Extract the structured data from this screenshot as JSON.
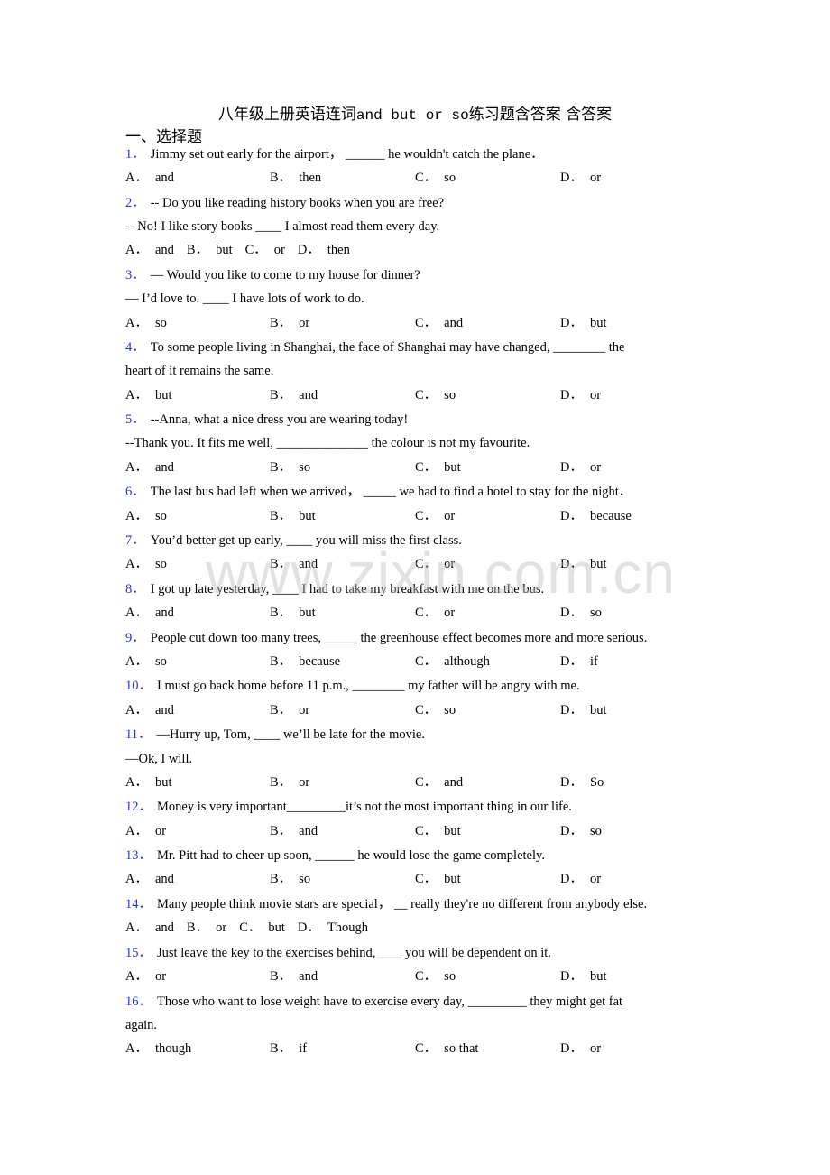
{
  "document": {
    "title_cn_prefix": "八年级上册英语连词",
    "title_en": "and but or  so",
    "title_cn_suffix": "练习题含答案 含答案",
    "section_heading": "一、选择题",
    "watermark": "www.zixin.com.cn",
    "accent_color": "#2a35d8"
  },
  "questions": [
    {
      "num": "1．",
      "lines": [
        "Jimmy set out early for the airport， ______ he wouldn't catch the plane．"
      ],
      "options": [
        {
          "letter": "A．",
          "text": "and"
        },
        {
          "letter": "B．",
          "text": "then"
        },
        {
          "letter": "C．",
          "text": "so"
        },
        {
          "letter": "D．",
          "text": "or"
        }
      ],
      "layout": "grid"
    },
    {
      "num": "2．",
      "lines": [
        "-- Do you like reading history books when you are free?",
        "-- No! I like story books ____ I almost read them every day."
      ],
      "options": [
        {
          "letter": "A．",
          "text": "and"
        },
        {
          "letter": "B．",
          "text": "but"
        },
        {
          "letter": "C．",
          "text": "or"
        },
        {
          "letter": "D．",
          "text": "then"
        }
      ],
      "layout": "inline"
    },
    {
      "num": "3．",
      "lines": [
        "— Would you like to come to my house for dinner?",
        "— I’d love to. ____ I have lots of work to do."
      ],
      "options": [
        {
          "letter": "A．",
          "text": "so"
        },
        {
          "letter": "B．",
          "text": "or"
        },
        {
          "letter": "C．",
          "text": "and"
        },
        {
          "letter": "D．",
          "text": "but"
        }
      ],
      "layout": "grid"
    },
    {
      "num": "4．",
      "lines": [
        "To some people living in Shanghai, the face of Shanghai may have changed, ________ the",
        "heart of it remains the same."
      ],
      "options": [
        {
          "letter": "A．",
          "text": "but"
        },
        {
          "letter": "B．",
          "text": "and"
        },
        {
          "letter": "C．",
          "text": "so"
        },
        {
          "letter": "D．",
          "text": "or"
        }
      ],
      "layout": "grid"
    },
    {
      "num": "5．",
      "lines": [
        "--Anna, what a nice dress you are wearing today!",
        "--Thank you. It fits me well, ______________ the colour is not my favourite."
      ],
      "options": [
        {
          "letter": "A．",
          "text": "and"
        },
        {
          "letter": "B．",
          "text": "so"
        },
        {
          "letter": "C．",
          "text": "but"
        },
        {
          "letter": "D．",
          "text": "or"
        }
      ],
      "layout": "grid"
    },
    {
      "num": "6．",
      "lines": [
        "The last bus had left when we arrived， _____ we had to find a hotel to stay for the night．"
      ],
      "options": [
        {
          "letter": "A．",
          "text": "so"
        },
        {
          "letter": "B．",
          "text": "but"
        },
        {
          "letter": "C．",
          "text": "or"
        },
        {
          "letter": "D．",
          "text": "because"
        }
      ],
      "layout": "grid"
    },
    {
      "num": "7．",
      "lines": [
        "You’d better get up early, ____ you will miss the first class."
      ],
      "options": [
        {
          "letter": "A．",
          "text": "so"
        },
        {
          "letter": "B．",
          "text": "and"
        },
        {
          "letter": "C．",
          "text": "or"
        },
        {
          "letter": "D．",
          "text": "but"
        }
      ],
      "layout": "grid"
    },
    {
      "num": "8．",
      "lines": [
        "I got up late yesterday, ____ I had to take my breakfast with me on the bus."
      ],
      "options": [
        {
          "letter": "A．",
          "text": "and"
        },
        {
          "letter": "B．",
          "text": "but"
        },
        {
          "letter": "C．",
          "text": "or"
        },
        {
          "letter": "D．",
          "text": "so"
        }
      ],
      "layout": "grid"
    },
    {
      "num": "9．",
      "lines": [
        "People cut down too many trees, _____ the greenhouse effect becomes more and more serious."
      ],
      "options": [
        {
          "letter": "A．",
          "text": "so"
        },
        {
          "letter": "B．",
          "text": "because"
        },
        {
          "letter": "C．",
          "text": "although"
        },
        {
          "letter": "D．",
          "text": "if"
        }
      ],
      "layout": "grid"
    },
    {
      "num": "10．",
      "lines": [
        "I must go back home before 11 p.m., ________ my father will be angry with me."
      ],
      "options": [
        {
          "letter": "A．",
          "text": "and"
        },
        {
          "letter": "B．",
          "text": "or"
        },
        {
          "letter": "C．",
          "text": "so"
        },
        {
          "letter": "D．",
          "text": "but"
        }
      ],
      "layout": "grid"
    },
    {
      "num": "11．",
      "lines": [
        "—Hurry up, Tom, ____ we’ll be late for the movie.",
        "—Ok, I will."
      ],
      "options": [
        {
          "letter": "A．",
          "text": "but"
        },
        {
          "letter": "B．",
          "text": "or"
        },
        {
          "letter": "C．",
          "text": "and"
        },
        {
          "letter": "D．",
          "text": "So"
        }
      ],
      "layout": "grid"
    },
    {
      "num": "12．",
      "lines": [
        "Money is very important_________it’s not the most important thing in our life."
      ],
      "options": [
        {
          "letter": "A．",
          "text": "or"
        },
        {
          "letter": "B．",
          "text": "and"
        },
        {
          "letter": "C．",
          "text": "but"
        },
        {
          "letter": "D．",
          "text": "so"
        }
      ],
      "layout": "grid"
    },
    {
      "num": "13．",
      "lines": [
        "Mr. Pitt had to cheer up soon, ______ he would lose the game completely."
      ],
      "options": [
        {
          "letter": "A．",
          "text": "and"
        },
        {
          "letter": "B．",
          "text": "so"
        },
        {
          "letter": "C．",
          "text": "but"
        },
        {
          "letter": "D．",
          "text": "or"
        }
      ],
      "layout": "grid"
    },
    {
      "num": "14．",
      "lines": [
        "Many people think movie stars are special，  __ really they're no different from anybody else."
      ],
      "options": [
        {
          "letter": "A．",
          "text": "and"
        },
        {
          "letter": "B．",
          "text": "or"
        },
        {
          "letter": "C．",
          "text": "but"
        },
        {
          "letter": "D．",
          "text": "Though"
        }
      ],
      "layout": "inline"
    },
    {
      "num": "15．",
      "lines": [
        "Just leave the key to the exercises behind,____ you will be dependent on it."
      ],
      "options": [
        {
          "letter": "A．",
          "text": "or"
        },
        {
          "letter": "B．",
          "text": "and"
        },
        {
          "letter": "C．",
          "text": "so"
        },
        {
          "letter": "D．",
          "text": "but"
        }
      ],
      "layout": "grid"
    },
    {
      "num": "16．",
      "lines": [
        "Those who want to lose weight have to exercise every day, _________ they might get fat",
        "again."
      ],
      "options": [
        {
          "letter": "A．",
          "text": "though"
        },
        {
          "letter": "B．",
          "text": "if"
        },
        {
          "letter": "C．",
          "text": "so that"
        },
        {
          "letter": "D．",
          "text": "or"
        }
      ],
      "layout": "grid"
    }
  ]
}
